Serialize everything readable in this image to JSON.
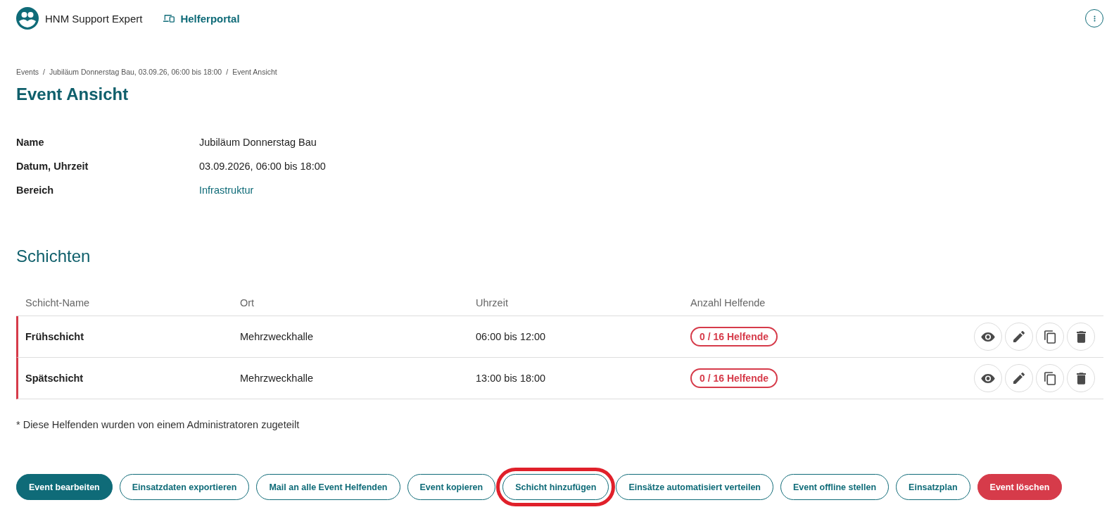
{
  "header": {
    "app_name": "HNM Support Expert",
    "portal_link": "Helferportal"
  },
  "breadcrumb": {
    "items": [
      "Events",
      "Jubiläum Donnerstag Bau, 03.09.26, 06:00 bis 18:00",
      "Event Ansicht"
    ],
    "separators": [
      "/",
      "/"
    ]
  },
  "title": "Event Ansicht",
  "details": [
    {
      "label": "Name",
      "value": "Jubiläum Donnerstag Bau",
      "kind": "text"
    },
    {
      "label": "Datum, Uhrzeit",
      "value": "03.09.2026, 06:00 bis 18:00",
      "kind": "text"
    },
    {
      "label": "Bereich",
      "value": "Infrastruktur",
      "kind": "link"
    }
  ],
  "shifts": {
    "heading": "Schichten",
    "columns": [
      "Schicht-Name",
      "Ort",
      "Uhrzeit",
      "Anzahl Helfende"
    ],
    "rows": [
      {
        "name": "Frühschicht",
        "location": "Mehrzweckhalle",
        "time": "06:00 bis 12:00",
        "helpers": "0 / 16 Helfende"
      },
      {
        "name": "Spätschicht",
        "location": "Mehrzweckhalle",
        "time": "13:00 bis 18:00",
        "helpers": "0 / 16 Helfende"
      }
    ]
  },
  "footnote": "* Diese Helfenden wurden von einem Administratoren zugeteilt",
  "buttons": [
    {
      "label": "Event bearbeiten",
      "kind": "primary",
      "highlighted": false
    },
    {
      "label": "Einsatzdaten exportieren",
      "kind": "outline",
      "highlighted": false
    },
    {
      "label": "Mail an alle Event Helfenden",
      "kind": "outline",
      "highlighted": false
    },
    {
      "label": "Event kopieren",
      "kind": "outline",
      "highlighted": false
    },
    {
      "label": "Schicht hinzufügen",
      "kind": "outline",
      "highlighted": true
    },
    {
      "label": "Einsätze automatisiert verteilen",
      "kind": "outline",
      "highlighted": false
    },
    {
      "label": "Event offline stellen",
      "kind": "outline",
      "highlighted": false
    },
    {
      "label": "Einsatzplan",
      "kind": "outline",
      "highlighted": false
    },
    {
      "label": "Event löschen",
      "kind": "danger",
      "highlighted": false
    }
  ]
}
